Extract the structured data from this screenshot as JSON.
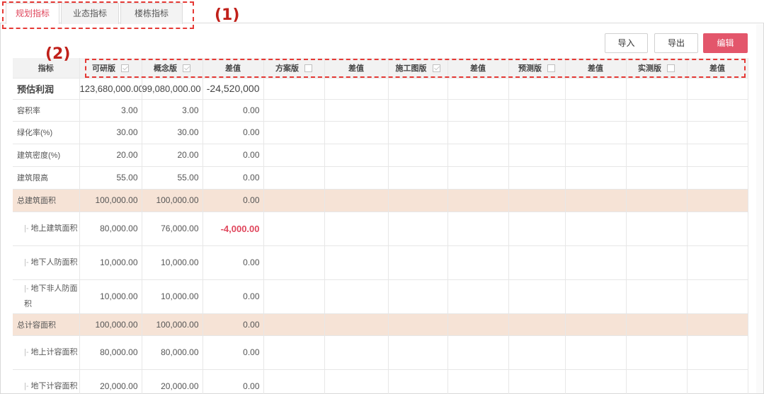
{
  "tabs": [
    {
      "label": "规划指标",
      "active": true
    },
    {
      "label": "业态指标",
      "active": false
    },
    {
      "label": "楼栋指标",
      "active": false
    }
  ],
  "annotations": {
    "label1": "(1)",
    "label2": "(2)"
  },
  "toolbar": {
    "import_label": "导入",
    "export_label": "导出",
    "edit_label": "编辑"
  },
  "colors": {
    "accent": "#e3566b",
    "negative": "#e0475d",
    "band": "#f6e3d6",
    "annotation": "#e53935"
  },
  "table": {
    "columns": [
      {
        "label": "指标",
        "checkbox": null
      },
      {
        "label": "可研版",
        "checkbox": true
      },
      {
        "label": "概念版",
        "checkbox": true
      },
      {
        "label": "差值",
        "checkbox": null
      },
      {
        "label": "方案版",
        "checkbox": false
      },
      {
        "label": "差值",
        "checkbox": null
      },
      {
        "label": "施工图版",
        "checkbox": true
      },
      {
        "label": "差值",
        "checkbox": null
      },
      {
        "label": "预测版",
        "checkbox": false
      },
      {
        "label": "差值",
        "checkbox": null
      },
      {
        "label": "实测版",
        "checkbox": false
      },
      {
        "label": "差值",
        "checkbox": null
      }
    ],
    "rows": [
      {
        "name": "预估利润",
        "v1": "123,680,000.00",
        "v2": "99,080,000.00",
        "diff": "-24,520,000",
        "negative": true,
        "band": false,
        "sub": false,
        "big": true
      },
      {
        "name": "容积率",
        "v1": "3.00",
        "v2": "3.00",
        "diff": "0.00",
        "negative": false,
        "band": false,
        "sub": false
      },
      {
        "name": "绿化率(%)",
        "v1": "30.00",
        "v2": "30.00",
        "diff": "0.00",
        "negative": false,
        "band": false,
        "sub": false
      },
      {
        "name": "建筑密度(%)",
        "v1": "20.00",
        "v2": "20.00",
        "diff": "0.00",
        "negative": false,
        "band": false,
        "sub": false
      },
      {
        "name": "建筑限高",
        "v1": "55.00",
        "v2": "55.00",
        "diff": "0.00",
        "negative": false,
        "band": false,
        "sub": false
      },
      {
        "name": "总建筑面积",
        "v1": "100,000.00",
        "v2": "100,000.00",
        "diff": "0.00",
        "negative": false,
        "band": true,
        "sub": false
      },
      {
        "name": "地上建筑面积",
        "v1": "80,000.00",
        "v2": "76,000.00",
        "diff": "-4,000.00",
        "negative": true,
        "band": false,
        "sub": true
      },
      {
        "name": "地下人防面积",
        "v1": "10,000.00",
        "v2": "10,000.00",
        "diff": "0.00",
        "negative": false,
        "band": false,
        "sub": true
      },
      {
        "name": "地下非人防面积",
        "v1": "10,000.00",
        "v2": "10,000.00",
        "diff": "0.00",
        "negative": false,
        "band": false,
        "sub": true
      },
      {
        "name": "总计容面积",
        "v1": "100,000.00",
        "v2": "100,000.00",
        "diff": "0.00",
        "negative": false,
        "band": true,
        "sub": false
      },
      {
        "name": "地上计容面积",
        "v1": "80,000.00",
        "v2": "80,000.00",
        "diff": "0.00",
        "negative": false,
        "band": false,
        "sub": true
      },
      {
        "name": "地下计容面积",
        "v1": "20,000.00",
        "v2": "20,000.00",
        "diff": "0.00",
        "negative": false,
        "band": false,
        "sub": true
      }
    ]
  }
}
